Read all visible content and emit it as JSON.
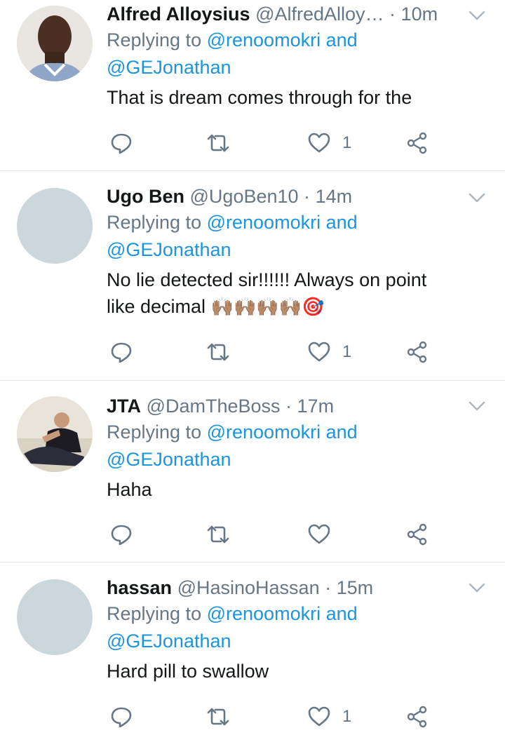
{
  "colors": {
    "link": "#1b95e0",
    "muted": "#657786",
    "text": "#14171a",
    "divider": "#e1e8ed",
    "avatar_placeholder": "#ccd6dd"
  },
  "tweets": [
    {
      "name": "Alfred Alloysius",
      "handle": "@AlfredAlloy…",
      "sep": "·",
      "time": "10m",
      "replying_prefix": "Replying to",
      "mention1": "@renoomokri",
      "and": "and",
      "mention2": "@GEJonathan",
      "text_line1": "That is dream comes through for the",
      "text_line2": "",
      "like_count": "1",
      "avatar": "photo"
    },
    {
      "name": "Ugo Ben",
      "handle": "@UgoBen10",
      "sep": "·",
      "time": "14m",
      "replying_prefix": "Replying to",
      "mention1": "@renoomokri",
      "and": "and",
      "mention2": "@GEJonathan",
      "text_line1": "No lie detected sir!!!!!! Always on point",
      "text_line2": "like decimal",
      "text_emoji": "🙌🏽🙌🏽🙌🏽🙌🏽🎯",
      "like_count": "1",
      "avatar": "placeholder"
    },
    {
      "name": "JTA",
      "handle": "@DamTheBoss",
      "sep": "·",
      "time": "17m",
      "replying_prefix": "Replying to",
      "mention1": "@renoomokri",
      "and": "and",
      "mention2": "@GEJonathan",
      "text_line1": "Haha",
      "text_line2": "",
      "like_count": "",
      "avatar": "photo"
    },
    {
      "name": "hassan",
      "handle": "@HasinoHassan",
      "sep": "·",
      "time": "15m",
      "replying_prefix": "Replying to",
      "mention1": "@renoomokri",
      "and": "and",
      "mention2": "@GEJonathan",
      "text_line1": "Hard pill to swallow",
      "text_line2": "",
      "like_count": "1",
      "avatar": "placeholder"
    }
  ],
  "icons": {
    "reply": "reply-icon",
    "retweet": "retweet-icon",
    "like": "heart-icon",
    "share": "share-icon",
    "menu": "chevron-down-icon"
  }
}
